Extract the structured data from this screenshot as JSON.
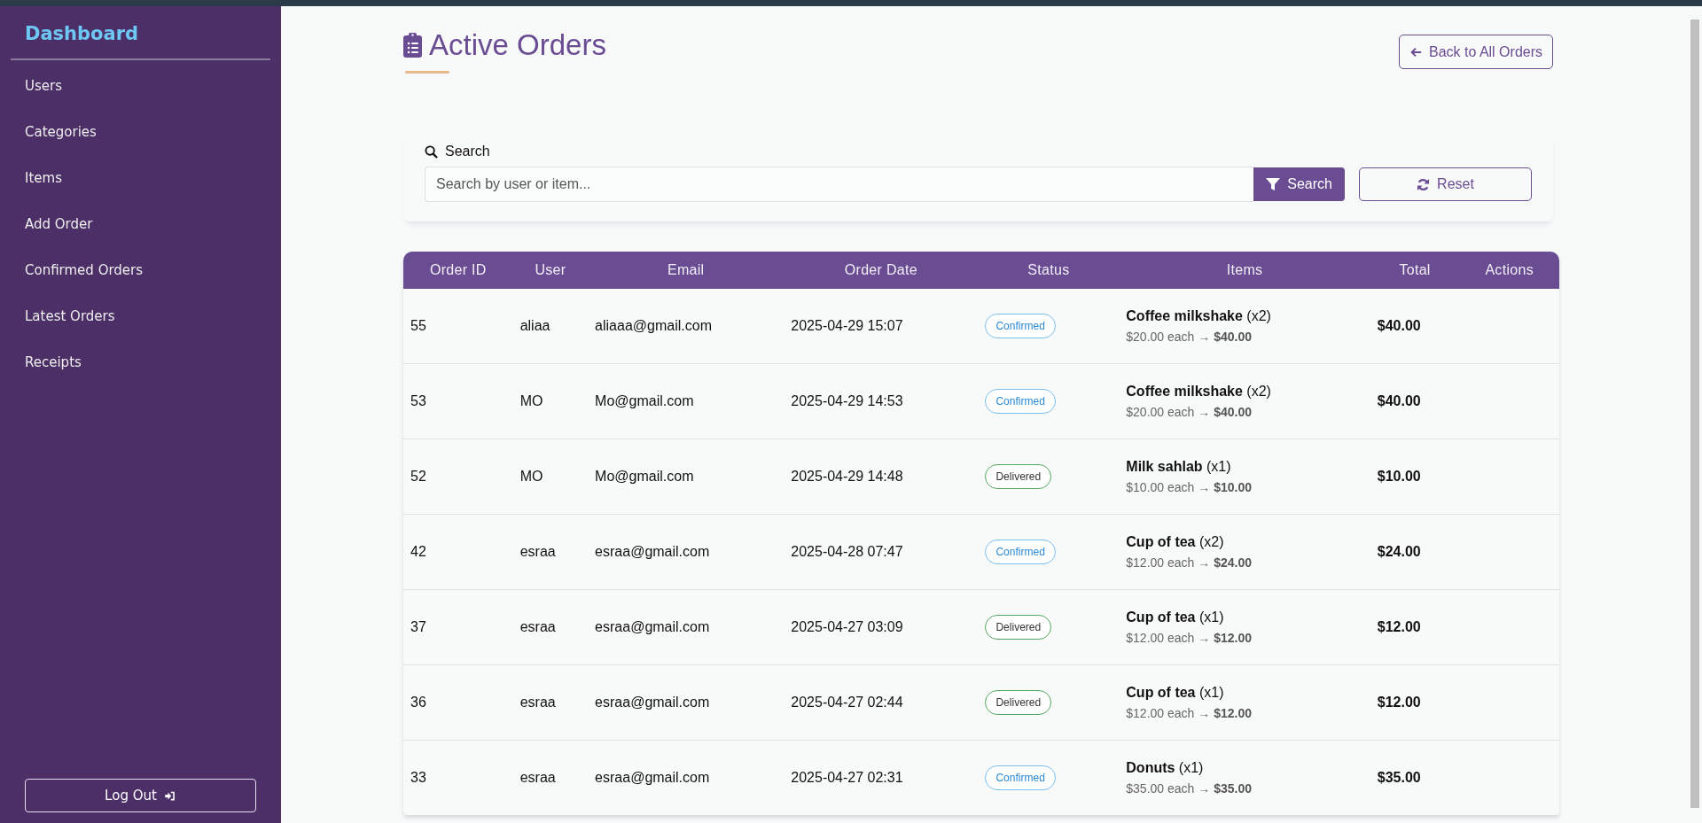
{
  "sidebar": {
    "title": "Dashboard",
    "items": [
      {
        "label": "Users"
      },
      {
        "label": "Categories"
      },
      {
        "label": "Items"
      },
      {
        "label": "Add Order"
      },
      {
        "label": "Confirmed Orders"
      },
      {
        "label": "Latest Orders"
      },
      {
        "label": "Receipts"
      }
    ],
    "logout": "Log Out"
  },
  "page": {
    "title": "Active Orders",
    "back_button": "Back to All Orders"
  },
  "search": {
    "label": "Search",
    "placeholder": "Search by user or item...",
    "button": "Search",
    "reset": "Reset"
  },
  "table": {
    "columns": [
      "Order ID",
      "User",
      "Email",
      "Order Date",
      "Status",
      "Items",
      "Total",
      "Actions"
    ],
    "rows": [
      {
        "id": "55",
        "user": "aliaa",
        "email": "aliaaa@gmail.com",
        "date": "2025-04-29 15:07",
        "status": "Confirmed",
        "kind": "confirmed",
        "item": "**Coffee milkshake** (x2)",
        "price": "$20.00 each → **$40.00**",
        "total": "$40.00"
      },
      {
        "id": "53",
        "user": "MO",
        "email": "Mo@gmail.com",
        "date": "2025-04-29 14:53",
        "status": "Confirmed",
        "kind": "confirmed",
        "item": "**Coffee milkshake** (x2)",
        "price": "$20.00 each → **$40.00**",
        "total": "$40.00"
      },
      {
        "id": "52",
        "user": "MO",
        "email": "Mo@gmail.com",
        "date": "2025-04-29 14:48",
        "status": "Delivered",
        "kind": "delivered",
        "item": "**Milk sahlab** (x1)",
        "price": "$10.00 each → **$10.00**",
        "total": "$10.00"
      },
      {
        "id": "42",
        "user": "esraa",
        "email": "esraa@gmail.com",
        "date": "2025-04-28 07:47",
        "status": "Confirmed",
        "kind": "confirmed",
        "item": "**Cup of tea** (x2)",
        "price": "$12.00 each → **$24.00**",
        "total": "$24.00"
      },
      {
        "id": "37",
        "user": "esraa",
        "email": "esraa@gmail.com",
        "date": "2025-04-27 03:09",
        "status": "Delivered",
        "kind": "delivered",
        "item": "**Cup of tea** (x1)",
        "price": "$12.00 each → **$12.00**",
        "total": "$12.00"
      },
      {
        "id": "36",
        "user": "esraa",
        "email": "esraa@gmail.com",
        "date": "2025-04-27 02:44",
        "status": "Delivered",
        "kind": "delivered",
        "item": "**Cup of tea** (x1)",
        "price": "$12.00 each → **$12.00**",
        "total": "$12.00"
      },
      {
        "id": "33",
        "user": "esraa",
        "email": "esraa@gmail.com",
        "date": "2025-04-27 02:31",
        "status": "Confirmed",
        "kind": "confirmed",
        "item": "**Donuts** (x1)",
        "price": "$35.00 each → **$35.00**",
        "total": "$35.00"
      }
    ]
  }
}
